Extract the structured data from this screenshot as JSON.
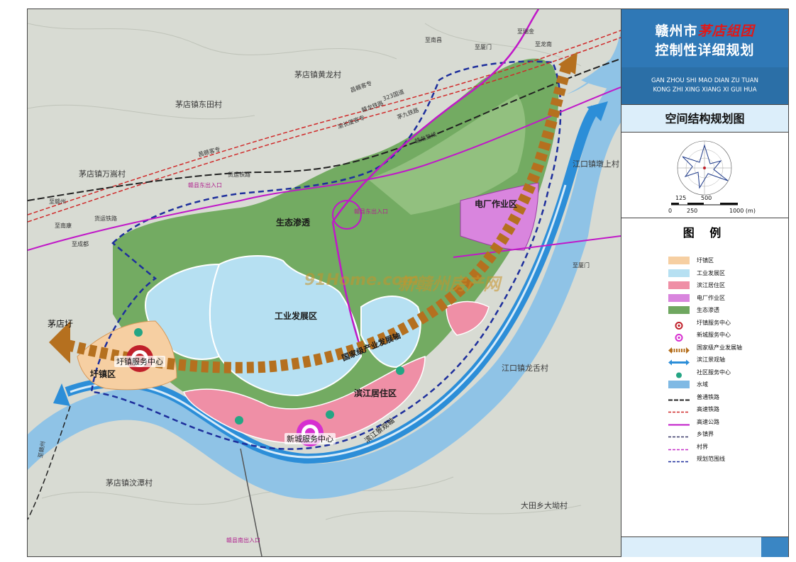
{
  "title": {
    "line1_prefix": "赣州市",
    "line1_brand": "茅店组团",
    "line2": "控制性详细规划",
    "pinyin_line1": "GAN ZHOU SHI MAO DIAN ZU TUAN",
    "pinyin_line2": "KONG ZHI XING XIANG XI GUI HUA",
    "subtitle": "空间结构规划图"
  },
  "scale": {
    "upper": [
      "125",
      "500"
    ],
    "lower": [
      "0",
      "250",
      "1000 (m)"
    ]
  },
  "legend": {
    "title": "图 例",
    "items": [
      {
        "label": "圩镇区",
        "color": "#f6cfa2",
        "kind": "fill"
      },
      {
        "label": "工业发展区",
        "color": "#b6e0f2",
        "kind": "fill"
      },
      {
        "label": "滨江居住区",
        "color": "#ef8fa6",
        "kind": "fill"
      },
      {
        "label": "电厂作业区",
        "color": "#d985de",
        "kind": "fill"
      },
      {
        "label": "生态渗透",
        "color": "#6fa760",
        "kind": "fill"
      },
      {
        "label": "圩镇服务中心",
        "color": "#c0202a",
        "kind": "ring"
      },
      {
        "label": "新城服务中心",
        "color": "#d62fd0",
        "kind": "ring"
      },
      {
        "label": "国家级产业发展轴",
        "color": "#b5701f",
        "kind": "dasharrow"
      },
      {
        "label": "滨江景观轴",
        "color": "#2c8ed8",
        "kind": "arrow"
      },
      {
        "label": "社区服务中心",
        "color": "#25a584",
        "kind": "dot"
      },
      {
        "label": "水域",
        "color": "#7fb9e4",
        "kind": "fill"
      },
      {
        "label": "普通铁路",
        "color": "#222222",
        "kind": "rail"
      },
      {
        "label": "高速铁路",
        "color": "#d02a2a",
        "kind": "dashline"
      },
      {
        "label": "高速公路",
        "color": "#c018c8",
        "kind": "line"
      },
      {
        "label": "乡镇界",
        "color": "#3a3a6a",
        "kind": "dashline"
      },
      {
        "label": "村界",
        "color": "#c42dc8",
        "kind": "dashline"
      },
      {
        "label": "规划范围线",
        "color": "#1e2f9c",
        "kind": "dashline"
      }
    ]
  },
  "map": {
    "villages": [
      "茅店镇黄龙村",
      "茅店镇东田村",
      "茅店镇万嵩村",
      "茅店圩",
      "茅店镇汶潭村",
      "大田乡大坳村",
      "江口镇龙舌村",
      "江口镇墩上村"
    ],
    "zones": [
      "生态渗透",
      "工业发展区",
      "电厂作业区",
      "滨江居住区",
      "圩镇区"
    ],
    "centers": [
      "圩镇服务中心",
      "新城服务中心"
    ],
    "axes": [
      "国家级产业发展轴",
      "滨江景观轴"
    ],
    "roads": [
      "至南昌",
      "至厦门",
      "至瑞金",
      "至赣州",
      "至南康",
      "至成都",
      "至厦门",
      "至龙南",
      "至赣州",
      "昌赣客专",
      "昌赣客专",
      "323国道",
      "货运铁路",
      "货运铁路",
      "渝长厦客专",
      "赣龙铁路",
      "赣龙复线",
      "茅九铁路"
    ],
    "entrances": [
      "赣县东出入口",
      "赣县南出入口",
      "赣县东出入口"
    ],
    "watermark": [
      "91Home.com",
      "新赣州房产网"
    ]
  }
}
